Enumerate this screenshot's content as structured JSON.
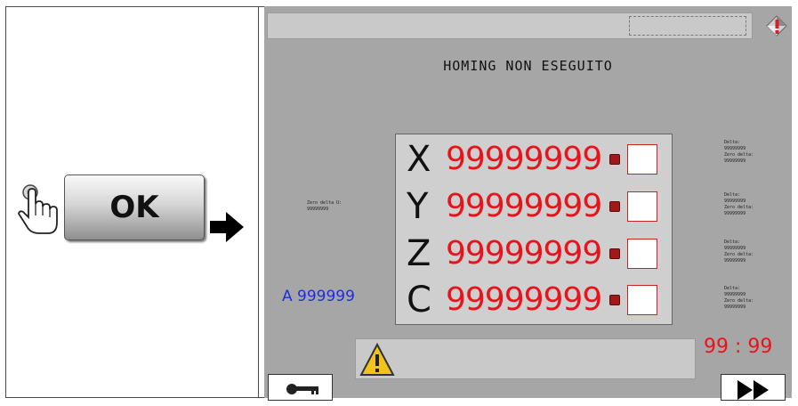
{
  "instruction": {
    "ok_label": "OK"
  },
  "screen": {
    "status_title": "HOMING NON ESEGUITO",
    "axes": [
      {
        "letter": "X",
        "value": "99999999"
      },
      {
        "letter": "Y",
        "value": "99999999"
      },
      {
        "letter": "Z",
        "value": "99999999"
      },
      {
        "letter": "C",
        "value": "99999999"
      }
    ],
    "zero_delta_left": "Zero delta U:\n99999999",
    "delta_blocks": [
      "Delta:\n99999999\nZero delta:\n99999999",
      "Delta:\n99999999\nZero delta:\n99999999",
      "Delta:\n99999999\nZero delta:\n99999999",
      "Delta:\n99999999\nZero delta:\n99999999"
    ],
    "a_value": "A 999999",
    "timer": "99 : 99"
  },
  "colors": {
    "value_red": "#e8131b",
    "a_blue": "#1f2fd6",
    "screen_gray": "#a6a6a6"
  },
  "icons": {
    "hand": "pointing-hand-icon",
    "arrow": "right-arrow-icon",
    "alarm": "alarm-icon",
    "warning": "warning-icon",
    "key": "key-icon",
    "forward": "fast-forward-icon"
  }
}
